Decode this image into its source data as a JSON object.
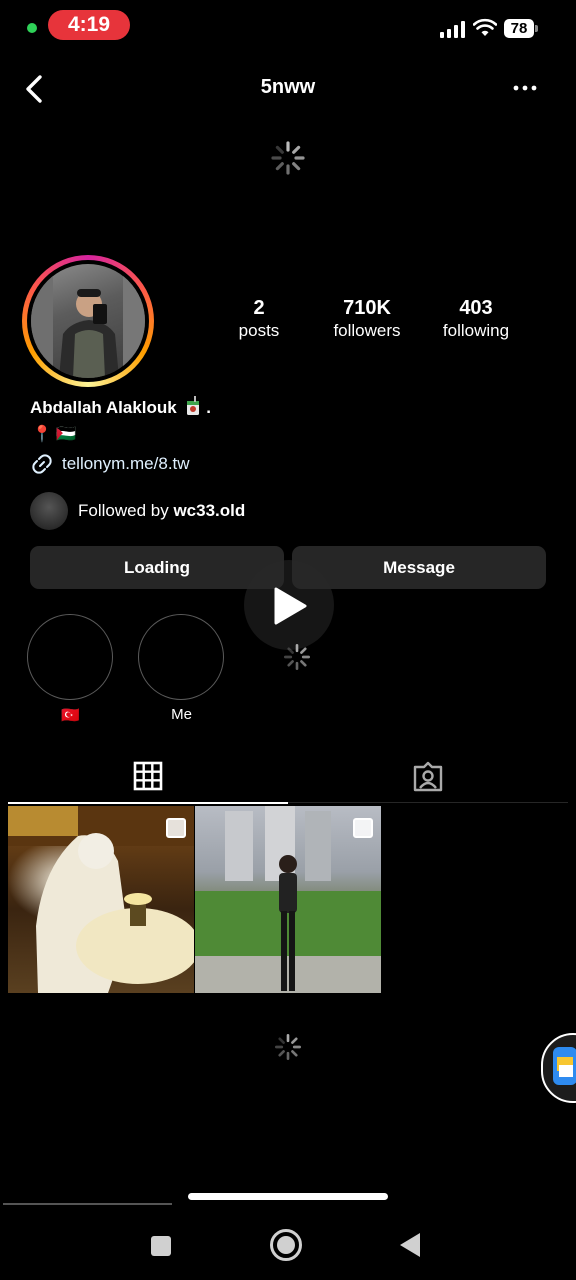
{
  "status_bar": {
    "time": "4:19",
    "battery": "78"
  },
  "header": {
    "username": "5nww",
    "back_icon": "chevron-left-icon",
    "more_icon": "more-horizontal-icon"
  },
  "profile": {
    "full_name": "Abdallah Alaklouk",
    "name_suffix": ".",
    "bio_emojis": "📍 🇵🇸",
    "link": "tellonym.me/8.tw",
    "followed_by_prefix": "Followed by",
    "followed_by_user": "wc33.old"
  },
  "stats": [
    {
      "value": "2",
      "label": "posts"
    },
    {
      "value": "710K",
      "label": "followers"
    },
    {
      "value": "403",
      "label": "following"
    }
  ],
  "actions": {
    "primary": "Loading",
    "secondary": "Message"
  },
  "highlights": [
    {
      "label": "🇹🇷"
    },
    {
      "label": "Me"
    }
  ],
  "tabs": [
    {
      "icon": "grid-icon",
      "active": true
    },
    {
      "icon": "tagged-user-icon",
      "active": false
    }
  ],
  "colors": {
    "background": "#000000",
    "button": "#262626",
    "status_pill": "#e7343b",
    "accent_link": "#e0f1ff"
  }
}
